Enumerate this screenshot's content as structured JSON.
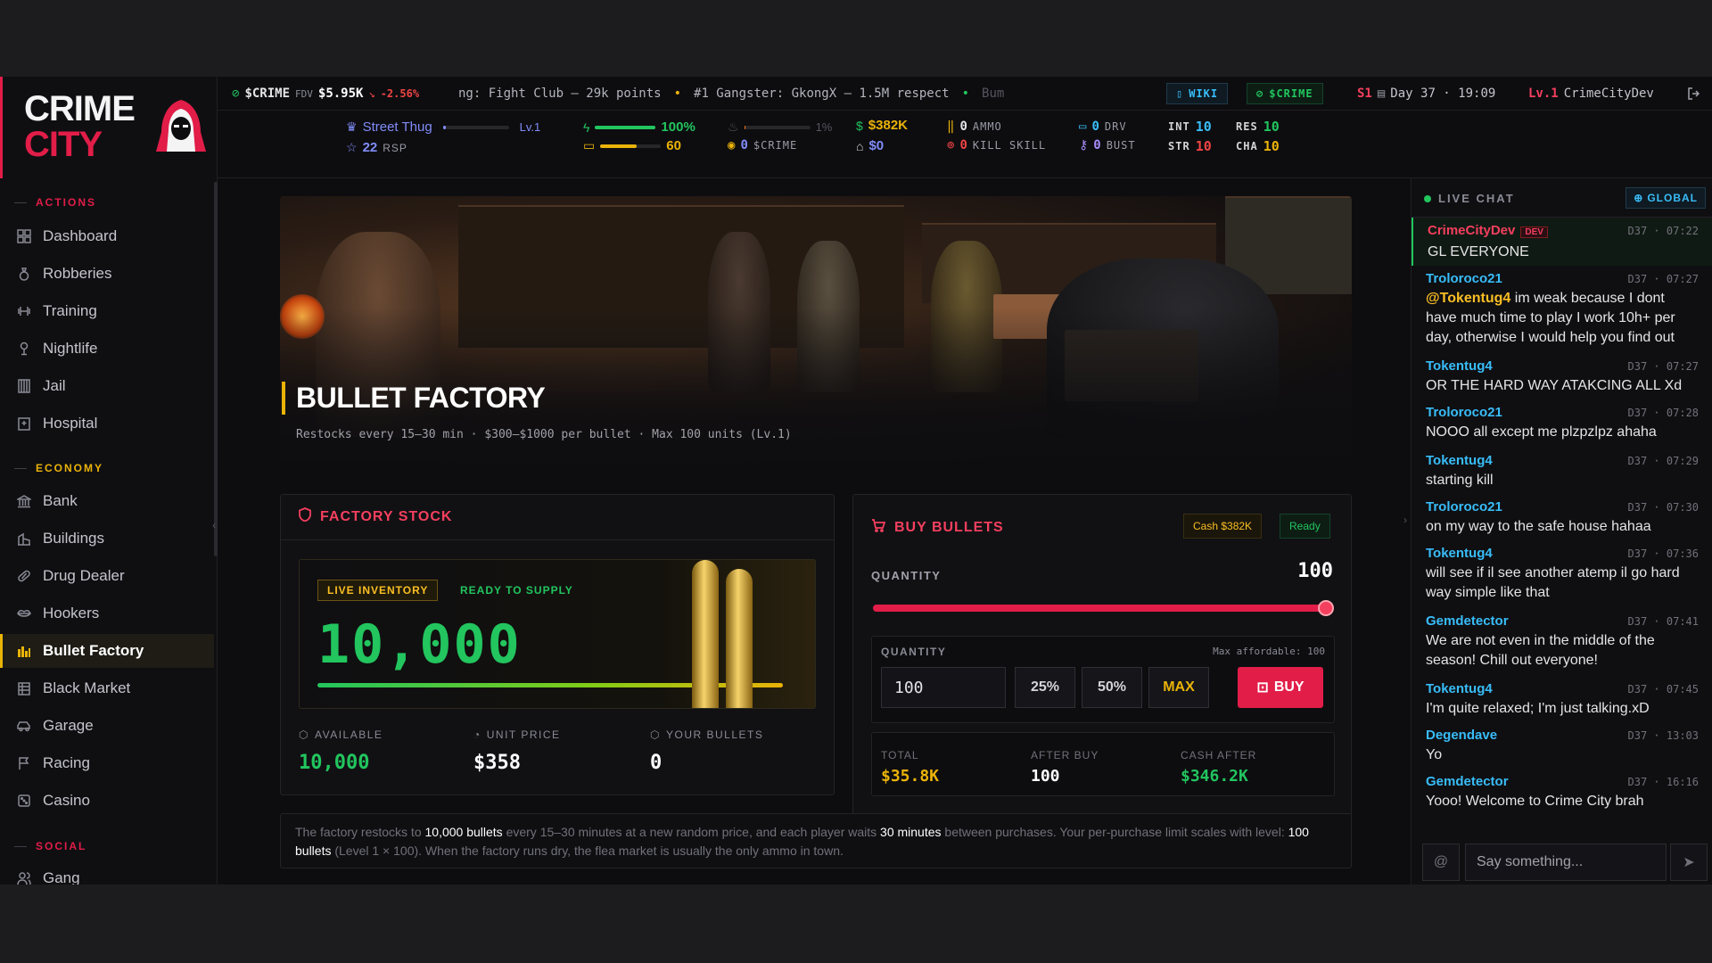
{
  "brand": {
    "line1": "CRIME",
    "line2": "CITY"
  },
  "nav": {
    "actions_label": "ACTIONS",
    "economy_label": "ECONOMY",
    "social_label": "SOCIAL",
    "actions": [
      "Dashboard",
      "Robberies",
      "Training",
      "Nightlife",
      "Jail",
      "Hospital"
    ],
    "economy": [
      "Bank",
      "Buildings",
      "Drug Dealer",
      "Hookers",
      "Bullet Factory",
      "Black Market",
      "Garage",
      "Racing",
      "Casino"
    ],
    "social": [
      "Gang"
    ],
    "active": "Bullet Factory"
  },
  "topbar": {
    "token": "$CRIME",
    "fdv_label": "FDV",
    "fdv": "$5.95K",
    "change": "-2.56%",
    "ticker1": "ng: Fight Club — 29k points",
    "ticker2": "#1 Gangster: GkongX — 1.5M respect",
    "ticker3": "Bum",
    "wiki": "WIKI",
    "crime": "$CRIME",
    "season": "S1",
    "day": "Day 37 · 19:09",
    "level": "Lv.1",
    "username": "CrimeCityDev"
  },
  "stats": {
    "rank": "Street Thug",
    "rank_level": "Lv.1",
    "respect": "22",
    "respect_label": "RSP",
    "energy": "100%",
    "energy_pct": 100,
    "nerve": "60",
    "nerve_pct": 60,
    "heat": "1%",
    "heat_pct": 1,
    "crime_tokens": "0",
    "crime_label": "$CRIME",
    "cash": "$382K",
    "bank": "$0",
    "ammo": "0",
    "ammo_label": "AMMO",
    "kill_skill": "0",
    "kill_label": "KILL SKILL",
    "drv": "0",
    "drv_label": "DRV",
    "bust": "0",
    "bust_label": "BUST",
    "int_label": "INT",
    "int": "10",
    "str_label": "STR",
    "str": "10",
    "res_label": "RES",
    "res": "10",
    "cha_label": "CHA",
    "cha": "10"
  },
  "hero": {
    "title": "BULLET FACTORY",
    "subtitle": "Restocks every 15–30 min · $300–$1000 per bullet · Max 100 units (Lv.1)"
  },
  "stock": {
    "title": "FACTORY STOCK",
    "live_tag": "LIVE INVENTORY",
    "ready_tag": "READY TO SUPPLY",
    "inventory": "10,000",
    "available_label": "AVAILABLE",
    "available": "10,000",
    "unit_price_label": "UNIT PRICE",
    "unit_price": "$358",
    "your_bullets_label": "YOUR BULLETS",
    "your_bullets": "0"
  },
  "buy": {
    "title": "BUY BULLETS",
    "cash_pill": "Cash  $382K",
    "ready_pill": "Ready",
    "quantity_label": "QUANTITY",
    "quantity_value": "100",
    "slider_pct": 100,
    "inner_label": "QUANTITY",
    "max_affordable": "Max affordable: 100",
    "input_value": "100",
    "pct25": "25%",
    "pct50": "50%",
    "max": "MAX",
    "buy_label": "BUY",
    "total_label": "TOTAL",
    "total": "$35.8K",
    "after_label": "AFTER BUY",
    "after": "100",
    "cash_after_label": "CASH AFTER",
    "cash_after": "$346.2K"
  },
  "info": {
    "t1": "The factory restocks to ",
    "b1": "10,000 bullets",
    "t2": " every 15–30 minutes at a new random price, and each player waits ",
    "b2": "30 minutes",
    "t3": " between purchases. Your per-purchase limit scales with level: ",
    "b3": "100 bullets",
    "t4": " (Level 1 × 100). When the factory runs dry, the flea market is usually the only ammo in town."
  },
  "chat": {
    "title": "LIVE CHAT",
    "scope": "GLOBAL",
    "placeholder": "Say something...",
    "messages": [
      {
        "user": "CrimeCityDev",
        "badge": "DEV",
        "time": "D37 · 07:22",
        "text": "GL EVERYONE"
      },
      {
        "user": "Troloroco21",
        "time": "D37 · 07:27",
        "mention": "@Tokentug4",
        "text": " im weak because I dont have much time to play I work 10h+ per day, otherwise I would help you find out"
      },
      {
        "user": "Tokentug4",
        "time": "D37 · 07:27",
        "text": "OR THE HARD WAY ATAKCING ALL Xd"
      },
      {
        "user": "Troloroco21",
        "time": "D37 · 07:28",
        "text": "NOOO all except me plzpzlpz ahaha"
      },
      {
        "user": "Tokentug4",
        "time": "D37 · 07:29",
        "text": "starting kill"
      },
      {
        "user": "Troloroco21",
        "time": "D37 · 07:30",
        "text": "on my way to the safe house hahaa"
      },
      {
        "user": "Tokentug4",
        "time": "D37 · 07:36",
        "text": "will see if il see another atemp il go hard way simple like that"
      },
      {
        "user": "Gemdetector",
        "time": "D37 · 07:41",
        "text": "We are not even in the middle of the season! Chill out everyone!"
      },
      {
        "user": "Tokentug4",
        "time": "D37 · 07:45",
        "text": "I'm quite relaxed; I'm just talking.xD"
      },
      {
        "user": "Degendave",
        "time": "D37 · 13:03",
        "text": "Yo"
      },
      {
        "user": "Gemdetector",
        "time": "D37 · 16:16",
        "text": "Yooo! Welcome to Crime City brah"
      }
    ]
  },
  "colors": {
    "accent_red": "#e11d48",
    "accent_gold": "#eab308",
    "accent_green": "#22c55e",
    "accent_blue": "#38bdf8"
  }
}
